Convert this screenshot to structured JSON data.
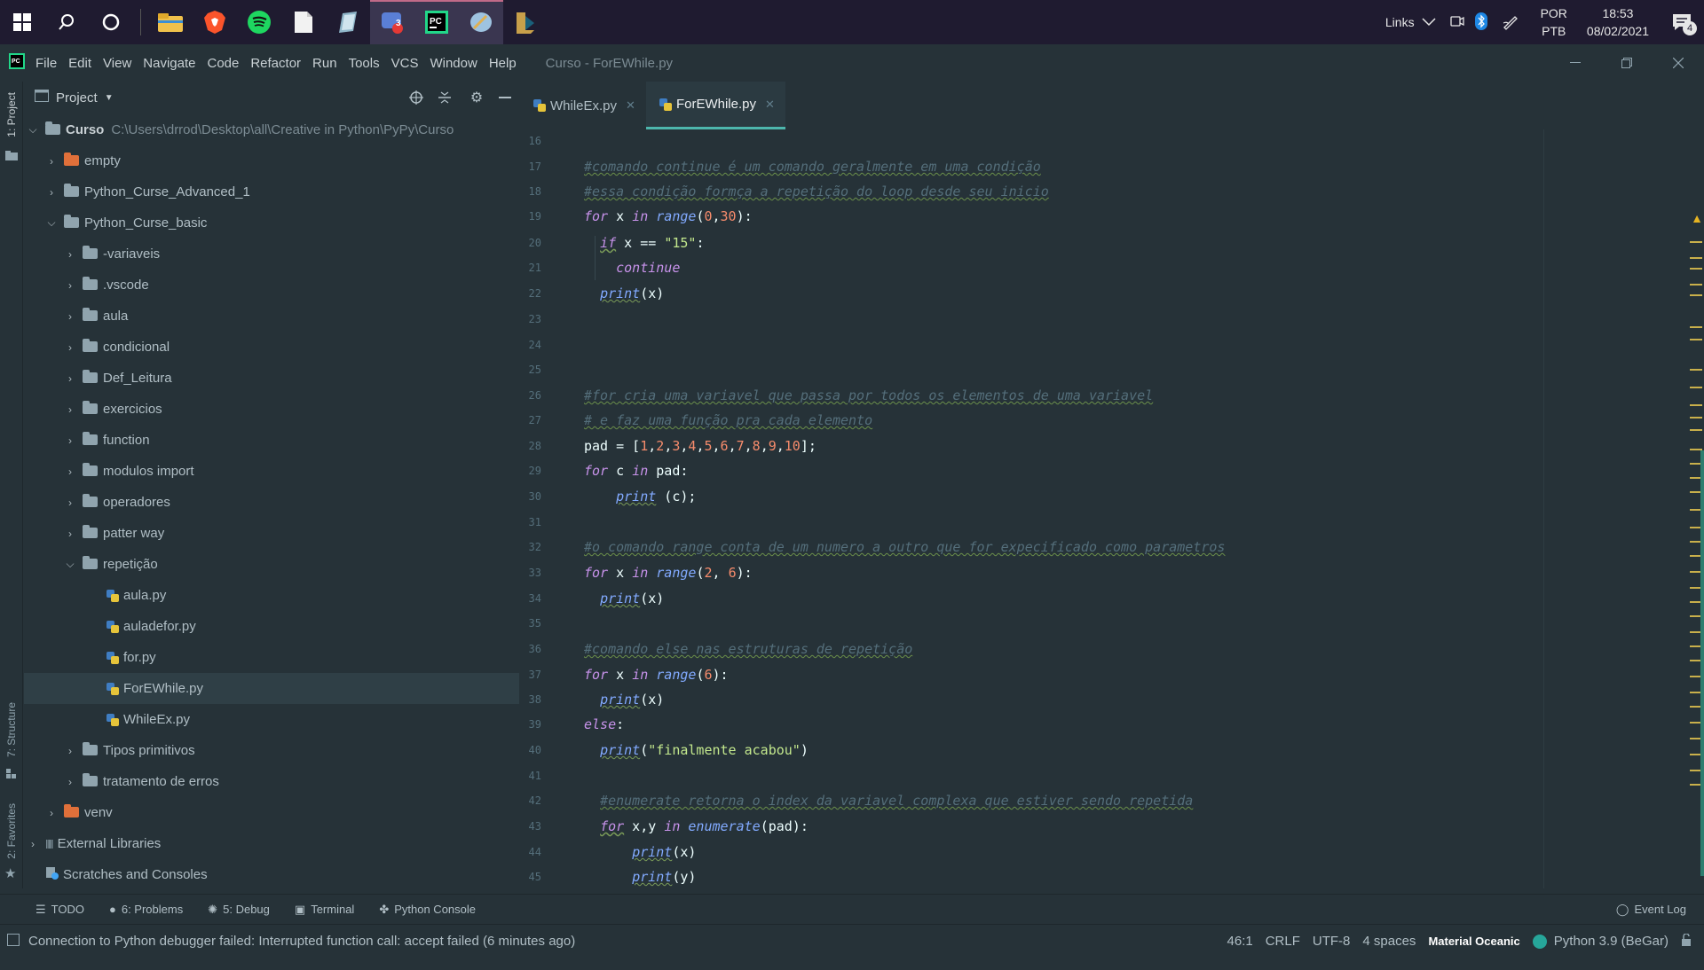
{
  "taskbar": {
    "links_label": "Links",
    "lang_top": "POR",
    "lang_bottom": "PTB",
    "time": "18:53",
    "date": "08/02/2021",
    "notif_count": "4",
    "chrome_badge": "3"
  },
  "menu": {
    "items": [
      "File",
      "Edit",
      "View",
      "Navigate",
      "Code",
      "Refactor",
      "Run",
      "Tools",
      "VCS",
      "Window",
      "Help"
    ],
    "title": "Curso - ForEWhile.py"
  },
  "left_strip": {
    "project": "1: Project",
    "structure": "7: Structure",
    "favorites": "2: Favorites"
  },
  "project": {
    "header": "Project",
    "root_name": "Curso",
    "root_path": "C:\\Users\\drrod\\Desktop\\all\\Creative in Python\\PyPy\\Curso",
    "items": [
      {
        "label": "empty"
      },
      {
        "label": "Python_Curse_Advanced_1"
      },
      {
        "label": "Python_Curse_basic"
      },
      {
        "label": "-variaveis"
      },
      {
        "label": ".vscode"
      },
      {
        "label": "aula"
      },
      {
        "label": "condicional"
      },
      {
        "label": "Def_Leitura"
      },
      {
        "label": "exercicios"
      },
      {
        "label": "function"
      },
      {
        "label": "modulos import"
      },
      {
        "label": "operadores"
      },
      {
        "label": "patter way"
      },
      {
        "label": "repetição"
      },
      {
        "label": "aula.py"
      },
      {
        "label": "auladefor.py"
      },
      {
        "label": "for.py"
      },
      {
        "label": "ForEWhile.py"
      },
      {
        "label": "WhileEx.py"
      },
      {
        "label": "Tipos primitivos"
      },
      {
        "label": "tratamento de erros"
      },
      {
        "label": "venv"
      },
      {
        "label": "External Libraries"
      },
      {
        "label": "Scratches and Consoles"
      }
    ]
  },
  "tabs": [
    {
      "label": "WhileEx.py"
    },
    {
      "label": "ForEWhile.py"
    }
  ],
  "toolwindows": {
    "todo": "TODO",
    "problems": "6: Problems",
    "debug": "5: Debug",
    "terminal": "Terminal",
    "console": "Python Console",
    "event_log": "Event Log"
  },
  "status": {
    "message": "Connection to Python debugger failed: Interrupted function call: accept failed (6 minutes ago)",
    "position": "46:1",
    "line_sep": "CRLF",
    "encoding": "UTF-8",
    "indent": "4 spaces",
    "theme": "Material Oceanic",
    "interpreter": "Python 3.9 (BeGar)"
  },
  "colors": {
    "background": "#263238",
    "accent": "#4db6ac",
    "keyword": "#c792ea",
    "function": "#82aaff",
    "string": "#c3e88d",
    "number": "#f78c6c",
    "comment": "#546e7a"
  }
}
